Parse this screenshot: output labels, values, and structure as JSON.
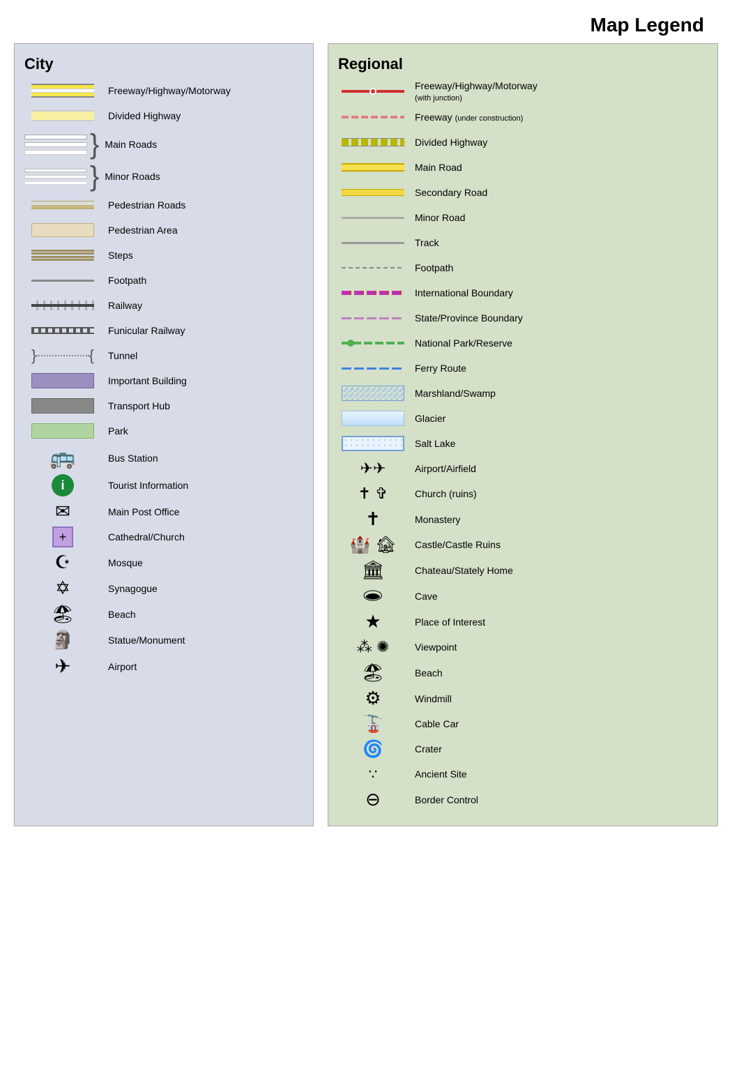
{
  "title": "Map Legend",
  "city": {
    "heading": "City",
    "items": [
      {
        "id": "freeway",
        "label": "Freeway/Highway/Motorway"
      },
      {
        "id": "divided-hwy",
        "label": "Divided Highway"
      },
      {
        "id": "main-roads",
        "label": "Main Roads"
      },
      {
        "id": "minor-roads",
        "label": "Minor Roads"
      },
      {
        "id": "ped-roads",
        "label": "Pedestrian Roads"
      },
      {
        "id": "ped-area",
        "label": "Pedestrian Area"
      },
      {
        "id": "steps",
        "label": "Steps"
      },
      {
        "id": "footpath",
        "label": "Footpath"
      },
      {
        "id": "railway",
        "label": "Railway"
      },
      {
        "id": "funicular",
        "label": "Funicular Railway"
      },
      {
        "id": "tunnel",
        "label": "Tunnel"
      },
      {
        "id": "important-bldg",
        "label": "Important Building"
      },
      {
        "id": "transport-hub",
        "label": "Transport Hub"
      },
      {
        "id": "park",
        "label": "Park"
      },
      {
        "id": "bus-station",
        "label": "Bus Station"
      },
      {
        "id": "tourist-info",
        "label": "Tourist Information"
      },
      {
        "id": "post-office",
        "label": "Main Post Office"
      },
      {
        "id": "cathedral",
        "label": "Cathedral/Church"
      },
      {
        "id": "mosque",
        "label": "Mosque"
      },
      {
        "id": "synagogue",
        "label": "Synagogue"
      },
      {
        "id": "beach-city",
        "label": "Beach"
      },
      {
        "id": "statue",
        "label": "Statue/Monument"
      },
      {
        "id": "airport-city",
        "label": "Airport"
      }
    ]
  },
  "regional": {
    "heading": "Regional",
    "items": [
      {
        "id": "reg-freeway",
        "label": "Freeway/Highway/Motorway",
        "sublabel": "(with junction)"
      },
      {
        "id": "reg-freeway-uc",
        "label": "Freeway",
        "sublabel": "(under construction)"
      },
      {
        "id": "reg-divhwy",
        "label": "Divided Highway"
      },
      {
        "id": "reg-mainroad",
        "label": "Main Road"
      },
      {
        "id": "reg-secroad",
        "label": "Secondary Road"
      },
      {
        "id": "reg-minroad",
        "label": "Minor Road"
      },
      {
        "id": "reg-track",
        "label": "Track"
      },
      {
        "id": "reg-footpath",
        "label": "Footpath"
      },
      {
        "id": "reg-intl-boundary",
        "label": "International Boundary"
      },
      {
        "id": "reg-state-boundary",
        "label": "State/Province Boundary"
      },
      {
        "id": "reg-natpark",
        "label": "National Park/Reserve"
      },
      {
        "id": "reg-ferry",
        "label": "Ferry Route"
      },
      {
        "id": "reg-marshland",
        "label": "Marshland/Swamp"
      },
      {
        "id": "reg-glacier",
        "label": "Glacier"
      },
      {
        "id": "reg-saltlake",
        "label": "Salt Lake"
      },
      {
        "id": "reg-airport",
        "label": "Airport/Airfield"
      },
      {
        "id": "reg-church",
        "label": "Church (ruins)"
      },
      {
        "id": "reg-monastery",
        "label": "Monastery"
      },
      {
        "id": "reg-castle",
        "label": "Castle/Castle Ruins"
      },
      {
        "id": "reg-chateau",
        "label": "Chateau/Stately Home"
      },
      {
        "id": "reg-cave",
        "label": "Cave"
      },
      {
        "id": "reg-place-interest",
        "label": "Place of Interest"
      },
      {
        "id": "reg-viewpoint",
        "label": "Viewpoint"
      },
      {
        "id": "reg-beach",
        "label": "Beach"
      },
      {
        "id": "reg-windmill",
        "label": "Windmill"
      },
      {
        "id": "reg-cablecar",
        "label": "Cable Car"
      },
      {
        "id": "reg-crater",
        "label": "Crater"
      },
      {
        "id": "reg-ancient",
        "label": "Ancient Site"
      },
      {
        "id": "reg-border",
        "label": "Border Control"
      }
    ]
  }
}
